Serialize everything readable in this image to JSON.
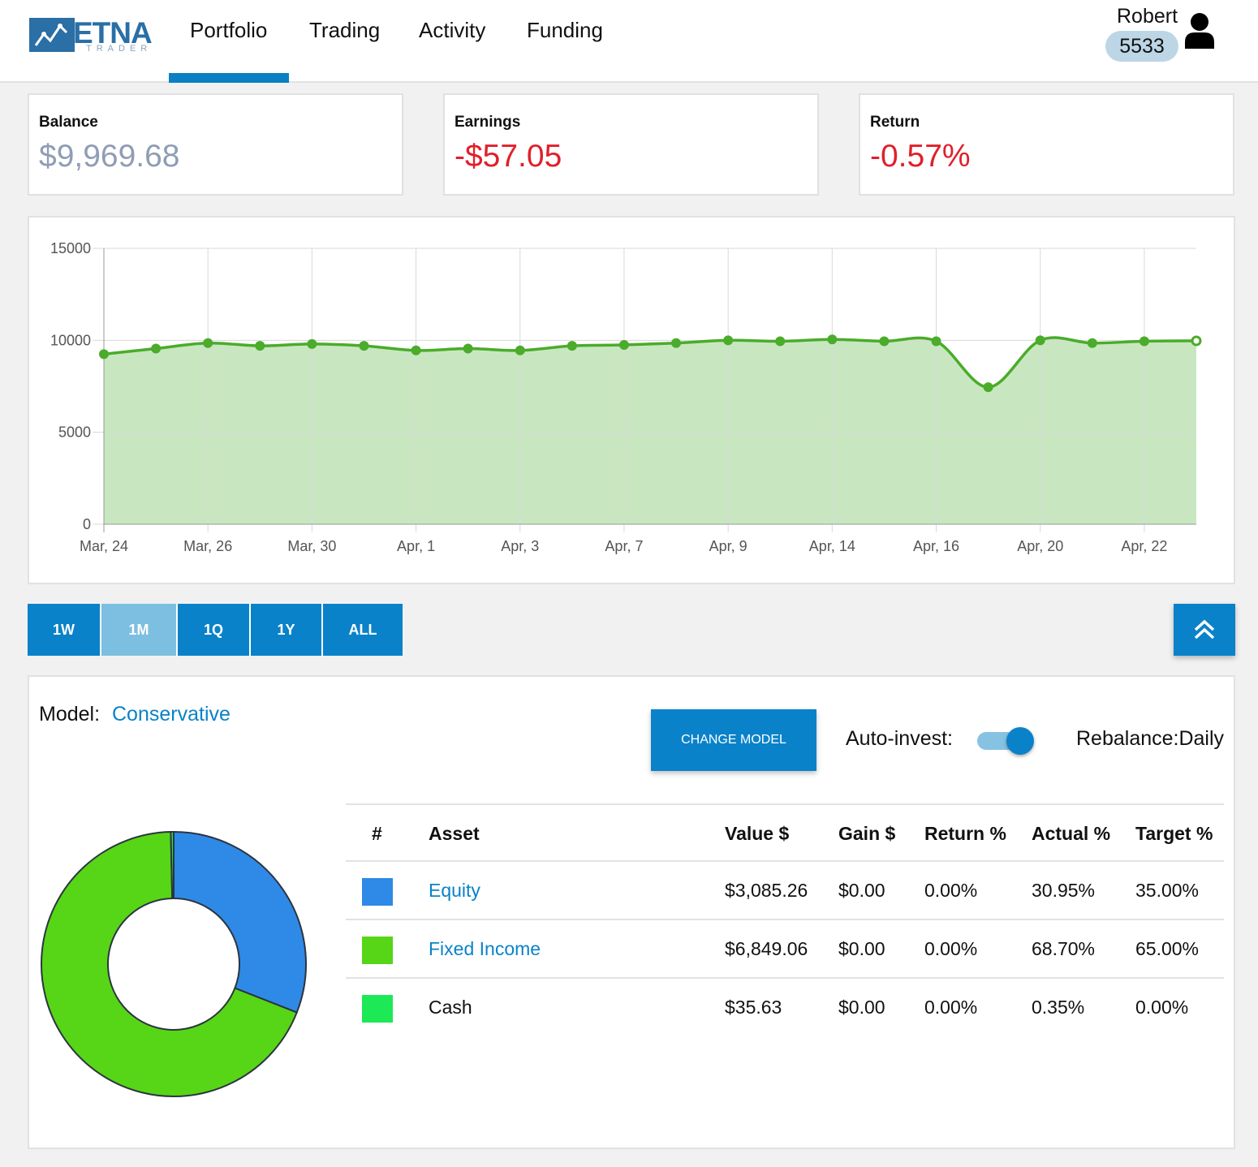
{
  "brand": {
    "name": "ETNA",
    "sub": "TRADER"
  },
  "nav": {
    "tabs": [
      "Portfolio",
      "Trading",
      "Activity",
      "Funding"
    ],
    "active": "Portfolio"
  },
  "user": {
    "name": "Robert",
    "account": "5533",
    "icon": "user-icon"
  },
  "stats": {
    "balance": {
      "label": "Balance",
      "value": "$9,969.68",
      "color": "#8f9db5"
    },
    "earnings": {
      "label": "Earnings",
      "value": "-$57.05",
      "color": "#e0202a"
    },
    "return": {
      "label": "Return",
      "value": "-0.57%",
      "color": "#e0202a"
    }
  },
  "chart_data": {
    "type": "area",
    "y_ticks": [
      "15000",
      "10000",
      "5000",
      "0"
    ],
    "ylim": [
      0,
      15000
    ],
    "x_tick_labels": [
      "Mar, 24",
      "Mar, 26",
      "Mar, 30",
      "Apr, 1",
      "Apr, 3",
      "Apr, 7",
      "Apr, 9",
      "Apr, 14",
      "Apr, 16",
      "Apr, 20",
      "Apr, 22"
    ],
    "values": [
      9250,
      9550,
      9850,
      9700,
      9800,
      9700,
      9450,
      9550,
      9450,
      9700,
      9750,
      9850,
      10000,
      9950,
      10050,
      9950,
      9950,
      7450,
      10000,
      9850,
      9950,
      9970
    ],
    "line_color": "#4aac2a",
    "fill_color": "#c8e7c0",
    "grid": true
  },
  "ranges": {
    "buttons": [
      "1W",
      "1M",
      "1Q",
      "1Y",
      "ALL"
    ],
    "active": "1M"
  },
  "model": {
    "label": "Model:",
    "name": "Conservative",
    "change_button": "CHANGE MODEL",
    "auto_invest_label": "Auto-invest:",
    "auto_invest_on": true,
    "rebalance_label": "Rebalance:Daily"
  },
  "allocation": {
    "columns": [
      "#",
      "Asset",
      "Value $",
      "Gain $",
      "Return %",
      "Actual %",
      "Target %"
    ],
    "rows": [
      {
        "color": "#2e8ae6",
        "asset": "Equity",
        "link": true,
        "value": "$3,085.26",
        "gain": "$0.00",
        "return": "0.00%",
        "actual": "30.95%",
        "target": "35.00%",
        "share": 30.95
      },
      {
        "color": "#56d616",
        "asset": "Fixed Income",
        "link": true,
        "value": "$6,849.06",
        "gain": "$0.00",
        "return": "0.00%",
        "actual": "68.70%",
        "target": "65.00%",
        "share": 68.7
      },
      {
        "color": "#1de856",
        "asset": "Cash",
        "link": false,
        "value": "$35.63",
        "gain": "$0.00",
        "return": "0.00%",
        "actual": "0.35%",
        "target": "0.00%",
        "share": 0.35
      }
    ]
  }
}
